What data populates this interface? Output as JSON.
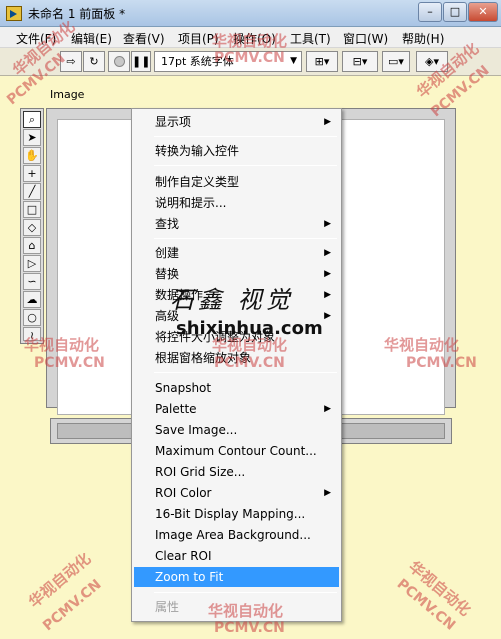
{
  "window": {
    "title": "未命名 1 前面板 *",
    "buttons": [
      "–",
      "□",
      "✕"
    ]
  },
  "menubar": {
    "items": [
      "文件(F)",
      "编辑(E)",
      "查看(V)",
      "项目(P)",
      "操作(O)",
      "工具(T)",
      "窗口(W)",
      "帮助(H)"
    ]
  },
  "toolbar": {
    "run_icon": "run-arrow-icon",
    "run_continuous_icon": "run-continuously-icon",
    "abort_icon": "abort-icon",
    "pause_icon": "pause-icon",
    "font_select": "17pt 系统字体",
    "align_icon": "align-objects-icon",
    "distribute_icon": "distribute-objects-icon",
    "resize_icon": "resize-objects-icon",
    "reorder_icon": "reorder-icon"
  },
  "panel": {
    "image_label": "Image",
    "tools": [
      "zoom-icon",
      "pointer-icon",
      "pan-icon",
      "point-icon",
      "line-icon",
      "rectangle-icon",
      "rotated-rectangle-icon",
      "polygon-icon",
      "freehand-polygon-icon",
      "freehand-line-icon",
      "annulus-icon",
      "oval-icon",
      "broken-line-icon"
    ]
  },
  "context_menu": {
    "group1": [
      {
        "label": "显示项",
        "submenu": true
      }
    ],
    "group2": [
      {
        "label": "转换为输入控件",
        "submenu": false
      }
    ],
    "group3": [
      {
        "label": "制作自定义类型",
        "submenu": false
      },
      {
        "label": "说明和提示...",
        "submenu": false
      },
      {
        "label": "查找",
        "submenu": true
      }
    ],
    "group4": [
      {
        "label": "创建",
        "submenu": true
      },
      {
        "label": "替换",
        "submenu": true
      },
      {
        "label": "数据操作",
        "submenu": true
      },
      {
        "label": "高级",
        "submenu": true
      },
      {
        "label": "将控件大小调整为对象",
        "submenu": false
      },
      {
        "label": "根据窗格缩放对象",
        "submenu": false
      }
    ],
    "group5": [
      {
        "label": "Snapshot",
        "submenu": false
      },
      {
        "label": "Palette",
        "submenu": true
      },
      {
        "label": "Save Image...",
        "submenu": false
      },
      {
        "label": "Maximum Contour Count...",
        "submenu": false
      },
      {
        "label": "ROI Grid Size...",
        "submenu": false
      },
      {
        "label": "ROI Color",
        "submenu": true
      },
      {
        "label": "16-Bit Display Mapping...",
        "submenu": false
      },
      {
        "label": "Image Area Background...",
        "submenu": false
      },
      {
        "label": "Clear ROI",
        "submenu": false
      },
      {
        "label": "Zoom to Fit",
        "submenu": false,
        "highlighted": true
      }
    ],
    "group6": [
      {
        "label": "属性",
        "submenu": false,
        "disabled": true
      }
    ]
  },
  "watermarks": {
    "cn": "华视自动化",
    "en": "PCMV.CN",
    "center_cn": "石鑫 视觉",
    "center_url": "shixinhua.com"
  }
}
